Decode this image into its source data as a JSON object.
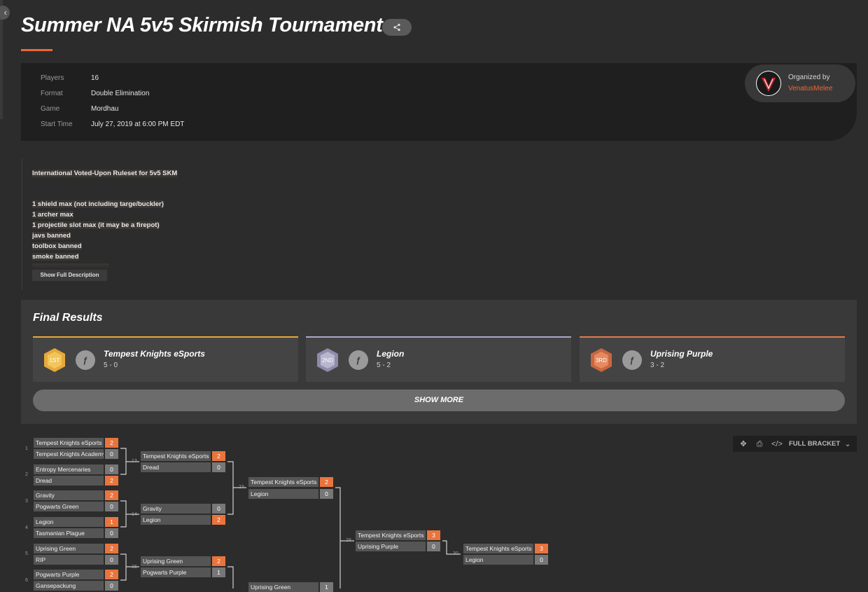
{
  "tournament": {
    "title": "Summer NA 5v5 Skirmish Tournament",
    "info": [
      {
        "key": "Players",
        "value": "16"
      },
      {
        "key": "Format",
        "value": "Double Elimination"
      },
      {
        "key": "Game",
        "value": "Mordhau"
      },
      {
        "key": "Start Time",
        "value": "July 27, 2019 at 6:00 PM EDT"
      }
    ],
    "organizer_label": "Organized by",
    "organizer_name": "VenatusMelee"
  },
  "description": {
    "lines": [
      "International Voted-Upon Ruleset for 5v5 SKM",
      "1 shield max (not including targe/buckler)",
      "1 archer max",
      "1 projectile slot max (it may be a firepot)",
      "javs banned",
      "toolbox banned",
      "smoke banned"
    ],
    "show_full_label": "Show Full Description"
  },
  "results": {
    "title": "Final Results",
    "places": [
      {
        "badge": "1ST",
        "team": "Tempest Knights eSports",
        "record": "5 - 0",
        "color": "#e6a93a"
      },
      {
        "badge": "2ND",
        "team": "Legion",
        "record": "5 - 2",
        "color": "#a9a6c9"
      },
      {
        "badge": "3RD",
        "team": "Uprising Purple",
        "record": "3 - 2",
        "color": "#e07a50"
      }
    ],
    "show_more_label": "SHOW MORE"
  },
  "bracket_toolbar": {
    "full_bracket_label": "FULL BRACKET",
    "icons": [
      "move-icon",
      "print-icon",
      "embed-code-icon",
      "chevron-down-icon"
    ]
  },
  "bracket": {
    "matches": [
      {
        "num": "1",
        "teams": [
          {
            "name": "Tempest Knights eSports",
            "score": "2",
            "win": true
          },
          {
            "name": "Tempest Knights Academy",
            "score": "0",
            "win": false
          }
        ]
      },
      {
        "num": "2",
        "teams": [
          {
            "name": "Entropy Mercenaries",
            "score": "0",
            "win": false
          },
          {
            "name": "Dread",
            "score": "2",
            "win": true
          }
        ]
      },
      {
        "num": "3",
        "teams": [
          {
            "name": "Gravity",
            "score": "2",
            "win": true
          },
          {
            "name": "Pogwarts Green",
            "score": "0",
            "win": false
          }
        ]
      },
      {
        "num": "4",
        "teams": [
          {
            "name": "Legion",
            "score": "1",
            "win": true
          },
          {
            "name": "Tasmanian Plague",
            "score": "0",
            "win": false
          }
        ]
      },
      {
        "num": "5",
        "teams": [
          {
            "name": "Uprising Green",
            "score": "2",
            "win": true
          },
          {
            "name": "RIP",
            "score": "0",
            "win": false
          }
        ]
      },
      {
        "num": "6",
        "teams": [
          {
            "name": "Pogwarts Purple",
            "score": "2",
            "win": true
          },
          {
            "name": "Gansepackung",
            "score": "0",
            "win": false
          }
        ]
      },
      {
        "num": "13",
        "teams": [
          {
            "name": "Tempest Knights eSports",
            "score": "2",
            "win": true
          },
          {
            "name": "Dread",
            "score": "0",
            "win": false
          }
        ]
      },
      {
        "num": "14",
        "teams": [
          {
            "name": "Gravity",
            "score": "0",
            "win": false
          },
          {
            "name": "Legion",
            "score": "2",
            "win": true
          }
        ]
      },
      {
        "num": "15",
        "teams": [
          {
            "name": "Uprising Green",
            "score": "2",
            "win": true
          },
          {
            "name": "Pogwarts Purple",
            "score": "1",
            "win": false
          }
        ]
      },
      {
        "num": "23",
        "teams": [
          {
            "name": "Tempest Knights eSports",
            "score": "2",
            "win": true
          },
          {
            "name": "Legion",
            "score": "0",
            "win": false
          }
        ]
      },
      {
        "num": "",
        "teams": [
          {
            "name": "Uprising Green",
            "score": "1",
            "win": false
          }
        ]
      },
      {
        "num": "28",
        "teams": [
          {
            "name": "Tempest Knights eSports",
            "score": "3",
            "win": true
          },
          {
            "name": "Uprising Purple",
            "score": "0",
            "win": false
          }
        ]
      },
      {
        "num": "30",
        "teams": [
          {
            "name": "Tempest Knights eSports",
            "score": "3",
            "win": true
          },
          {
            "name": "Legion",
            "score": "0",
            "win": false
          }
        ]
      }
    ]
  }
}
